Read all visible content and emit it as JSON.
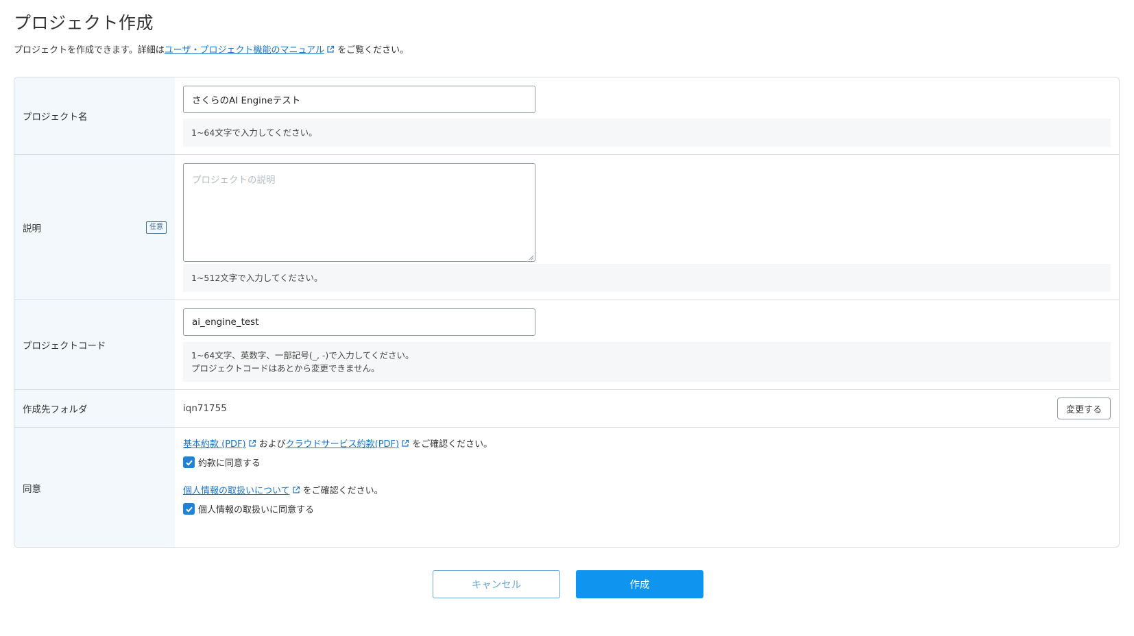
{
  "page": {
    "title": "プロジェクト作成",
    "intro_prefix": "プロジェクトを作成できます。詳細は",
    "intro_link": "ユーザ・プロジェクト機能のマニュアル",
    "intro_suffix": "をご覧ください。"
  },
  "form": {
    "project_name": {
      "label": "プロジェクト名",
      "value": "さくらのAI Engineテスト",
      "help": "1~64文字で入力してください。"
    },
    "description": {
      "label": "説明",
      "badge": "任意",
      "placeholder": "プロジェクトの説明",
      "help": "1~512文字で入力してください。"
    },
    "project_code": {
      "label": "プロジェクトコード",
      "value": "ai_engine_test",
      "help_line1": "1~64文字、英数字、一部記号(_, -)で入力してください。",
      "help_line2": "プロジェクトコードはあとから変更できません。"
    },
    "folder": {
      "label": "作成先フォルダ",
      "value": "iqn71755",
      "change_button": "変更する"
    },
    "consent": {
      "label": "同意",
      "terms_link1": "基本約款 (PDF)",
      "terms_and": "および",
      "terms_link2": "クラウドサービス約款(PDF)",
      "terms_suffix": "をご確認ください。",
      "terms_checkbox": "約款に同意する",
      "terms_checked": true,
      "privacy_link": "個人情報の取扱いについて",
      "privacy_suffix": "をご確認ください。",
      "privacy_checkbox": "個人情報の取扱いに同意する",
      "privacy_checked": true
    }
  },
  "actions": {
    "cancel": "キャンセル",
    "create": "作成"
  },
  "colors": {
    "primary": "#0f95f0",
    "link": "#1a73c8",
    "label_bg": "#f3f8fc",
    "checkbox": "#1f82d6"
  },
  "icons": {
    "external_link": "external-link-icon",
    "checkmark": "checkmark-icon"
  }
}
